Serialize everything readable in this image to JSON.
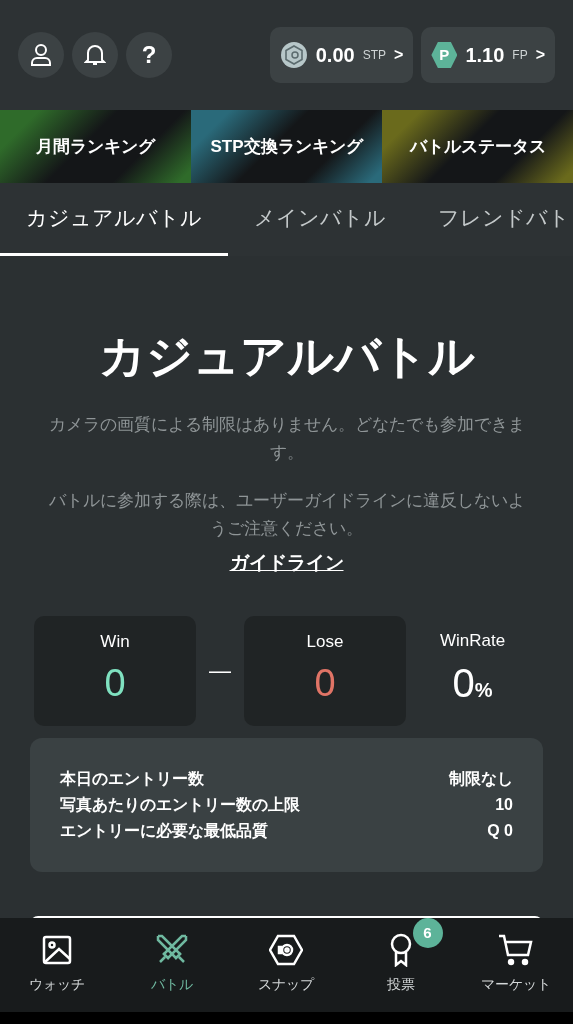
{
  "header": {
    "icon_buttons": [
      {
        "kind": "user"
      },
      {
        "kind": "bell"
      },
      {
        "kind": "help",
        "label": "?"
      }
    ],
    "balances": [
      {
        "kind": "stp",
        "amount": "0.00",
        "unit": "STP",
        "chevron": ">"
      },
      {
        "kind": "fp",
        "badge": "P",
        "amount": "1.10",
        "unit": "FP",
        "chevron": ">"
      }
    ]
  },
  "banners": [
    {
      "label": "月間ランキング",
      "color": "#2f6b2a"
    },
    {
      "label": "STP交換ランキング",
      "color": "#2a6a7a"
    },
    {
      "label": "バトルステータス",
      "color": "#6a6a1c"
    }
  ],
  "tabs": [
    {
      "label": "カジュアルバトル",
      "selected": true
    },
    {
      "label": "メインバトル",
      "selected": false
    },
    {
      "label": "フレンドバト",
      "selected": false
    }
  ],
  "title": "カジュアルバトル",
  "paragraphs": [
    "カメラの画質による制限はありません。どなたでも参加できます。",
    "バトルに参加する際は、ユーザーガイドラインに違反しないようご注意ください。"
  ],
  "guideline_link": "ガイドライン",
  "stats": {
    "win": {
      "label": "Win",
      "value": "0"
    },
    "separator": "—",
    "lose": {
      "label": "Lose",
      "value": "0"
    },
    "winrate": {
      "label": "WinRate",
      "value": "0",
      "unit": "%"
    }
  },
  "limits": [
    {
      "label": "本日のエントリー数",
      "value": "制限なし"
    },
    {
      "label": "写真あたりのエントリー数の上限",
      "value": "10"
    },
    {
      "label": "エントリーに必要な最低品質",
      "value": "Q 0"
    }
  ],
  "bottom_nav": [
    {
      "kind": "watch",
      "label": "ウォッチ",
      "selected": false
    },
    {
      "kind": "battle",
      "label": "バトル",
      "selected": true
    },
    {
      "kind": "snap",
      "label": "スナップ",
      "selected": false
    },
    {
      "kind": "vote",
      "label": "投票",
      "selected": false,
      "badge": "6"
    },
    {
      "kind": "market",
      "label": "マーケット",
      "selected": false
    }
  ]
}
